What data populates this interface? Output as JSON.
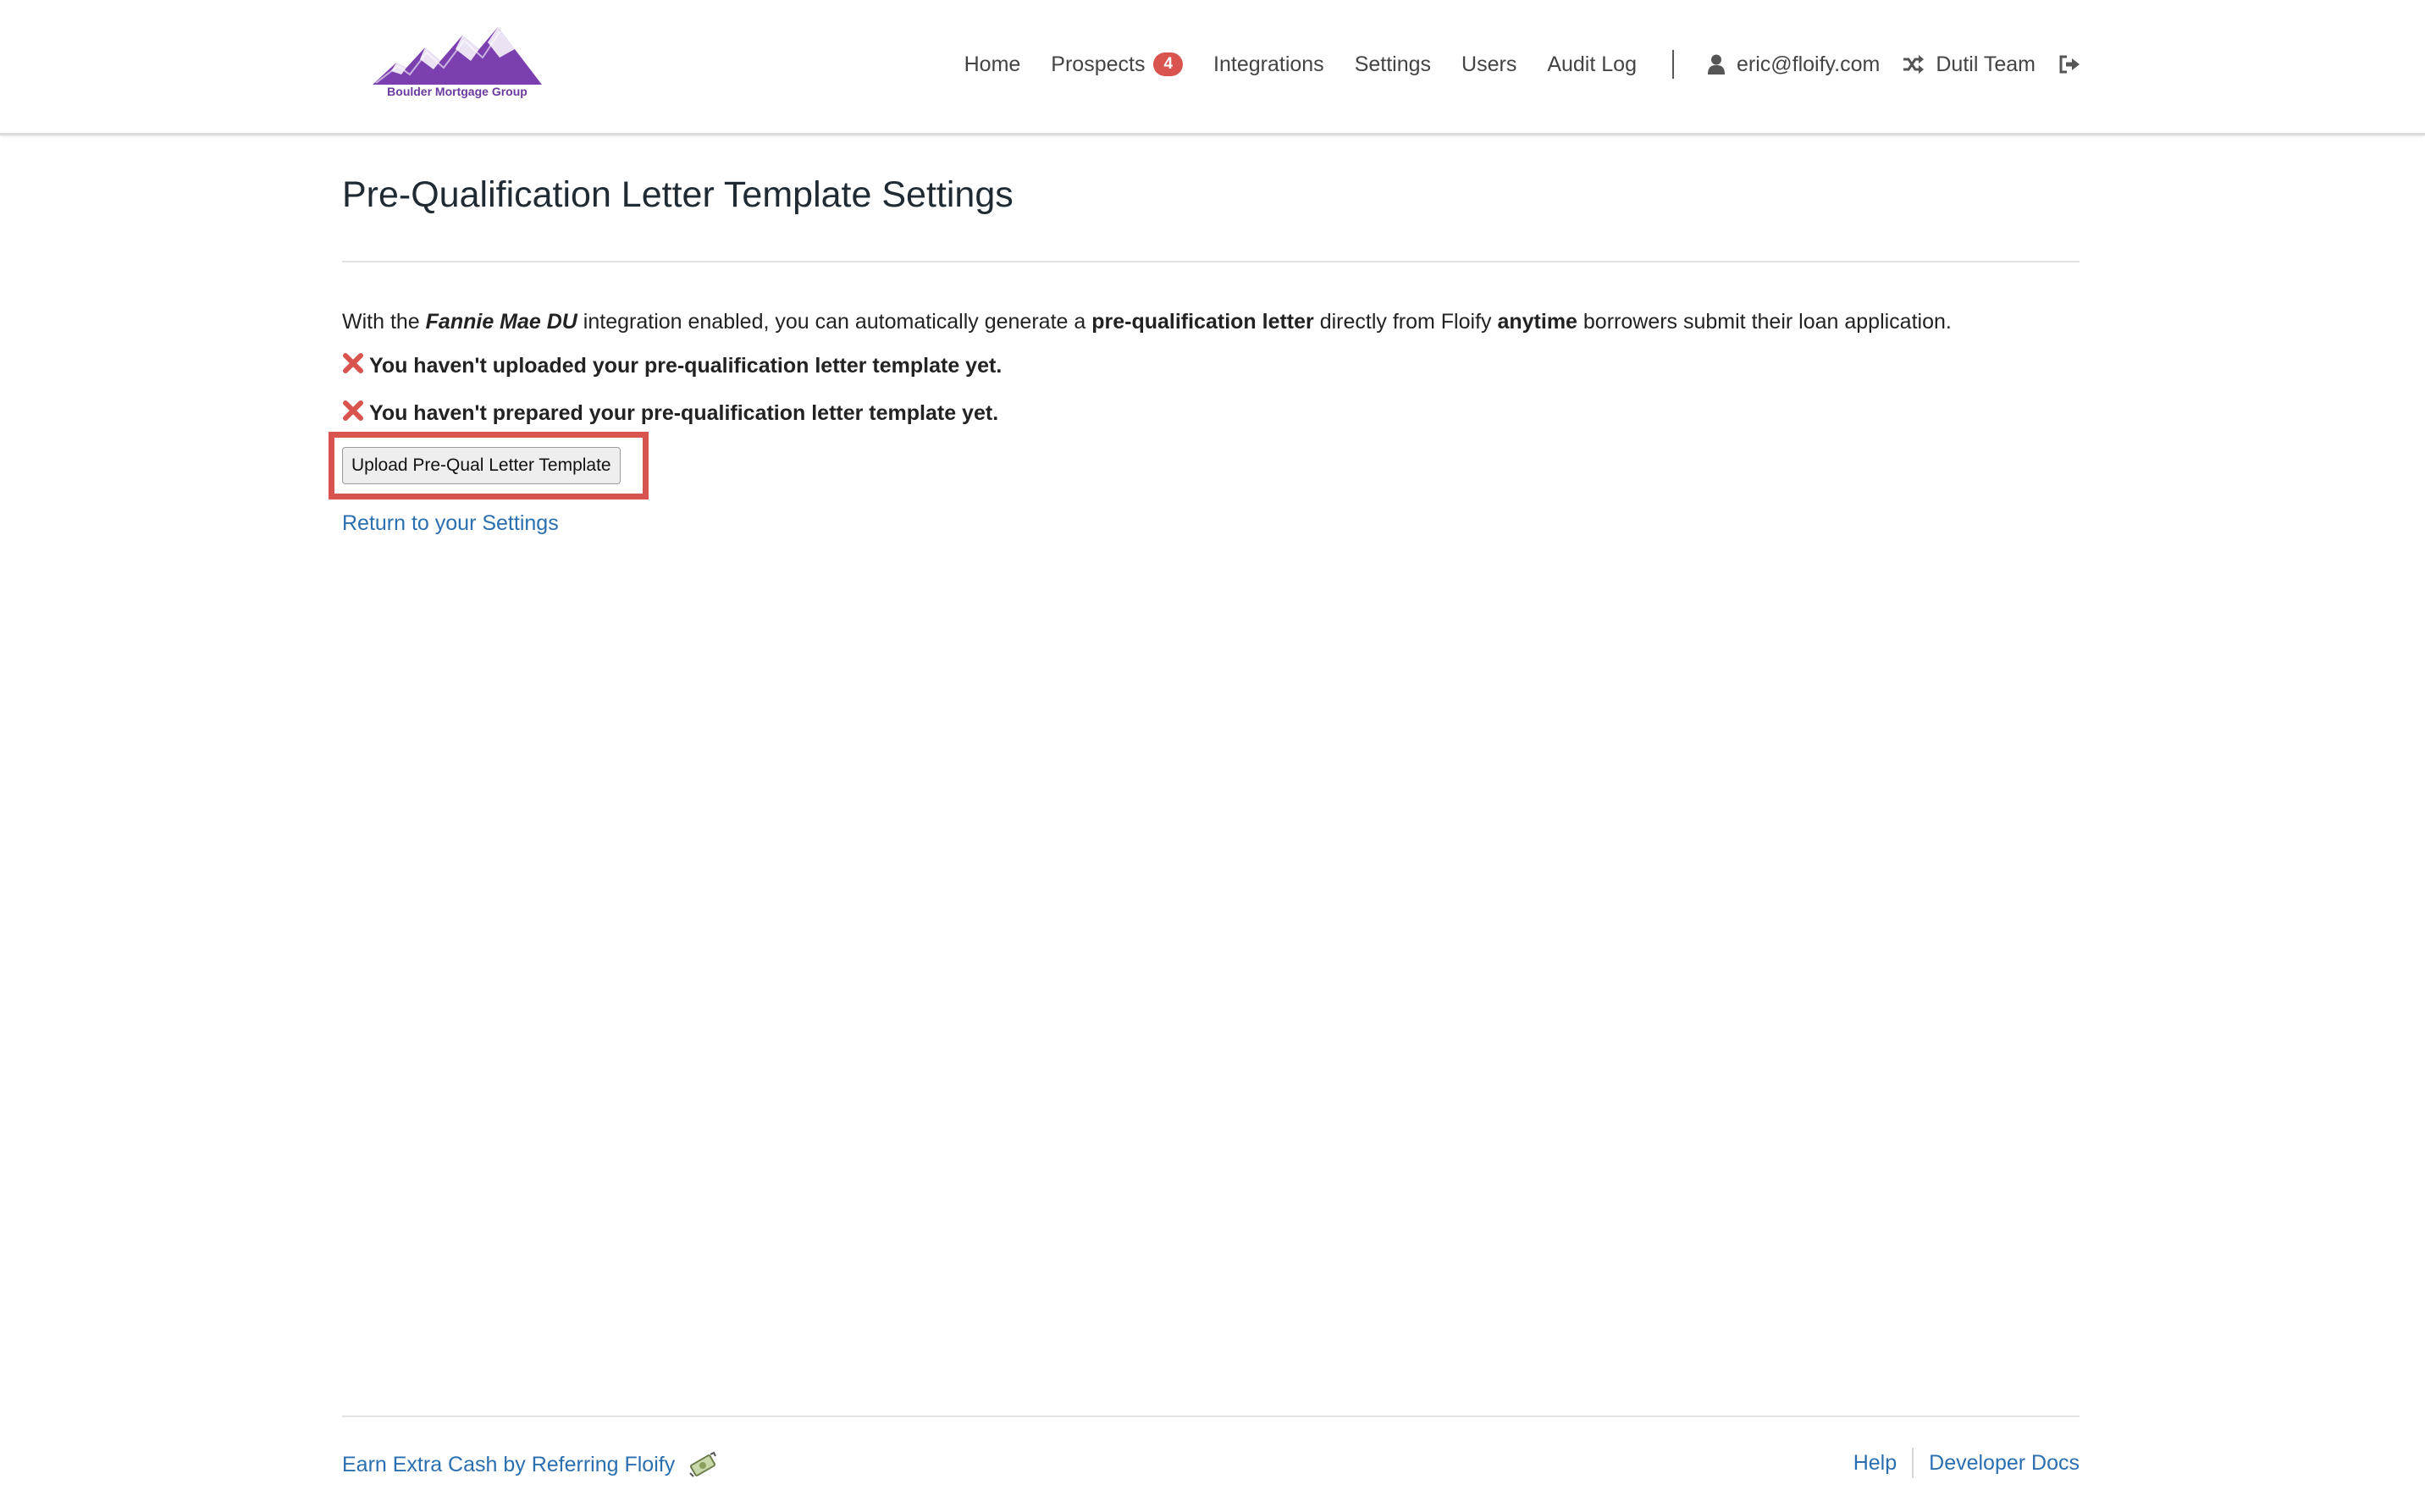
{
  "header": {
    "logo_text": "Boulder Mortgage Group",
    "nav": {
      "home": "Home",
      "prospects": "Prospects",
      "prospects_badge": "4",
      "integrations": "Integrations",
      "settings": "Settings",
      "users": "Users",
      "audit_log": "Audit Log"
    },
    "user_email": "eric@floify.com",
    "team_name": "Dutil Team",
    "icons": {
      "user": "user-icon",
      "switch_team": "shuffle-icon",
      "logout": "sign-out-icon"
    }
  },
  "main": {
    "title": "Pre-Qualification Letter Template Settings",
    "intro": {
      "part1": "With the ",
      "integration_name": "Fannie Mae DU",
      "part2": " integration enabled, you can automatically generate a ",
      "bold_letter": "pre-qualification letter",
      "part3": " directly from Floify ",
      "bold_anytime": "anytime",
      "part4": " borrowers submit their loan application."
    },
    "status_items": [
      {
        "icon": "x-mark-icon",
        "text": "You haven't uploaded your pre-qualification letter template yet."
      },
      {
        "icon": "x-mark-icon",
        "text": "You haven't prepared your pre-qualification letter template yet."
      }
    ],
    "upload_button": "Upload Pre-Qual Letter Template",
    "return_link": "Return to your Settings"
  },
  "footer": {
    "referral": "Earn Extra Cash by Referring Floify",
    "referral_icon": "money-icon",
    "help": "Help",
    "developer_docs": "Developer Docs"
  },
  "colors": {
    "accent_link": "#2a6fb0",
    "error_red": "#d9534f",
    "logo_purple": "#6a3aa0"
  }
}
